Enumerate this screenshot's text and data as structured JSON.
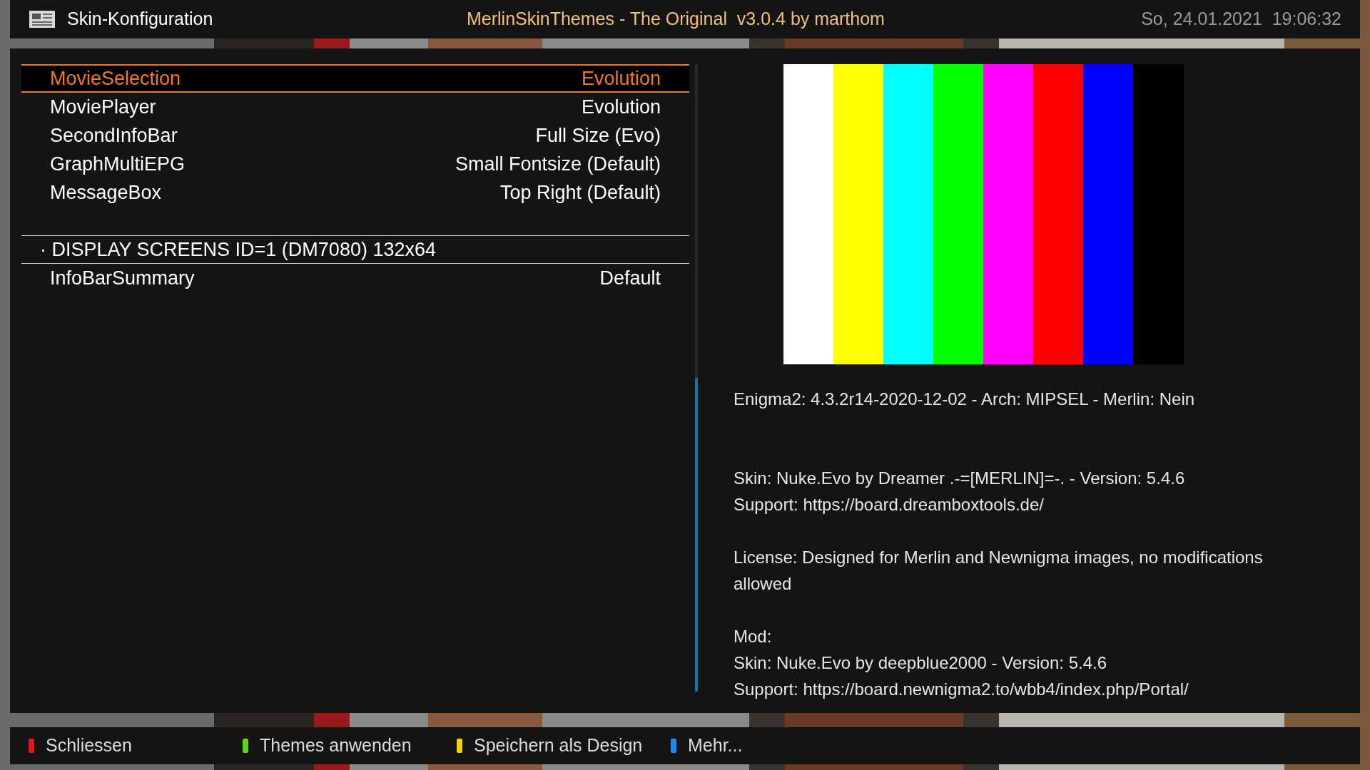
{
  "header": {
    "title": "Skin-Konfiguration",
    "center_title": "MerlinSkinThemes - The Original  v3.0.4 by marthom",
    "datetime": "So, 24.01.2021  19:06:32"
  },
  "list": {
    "rows": [
      {
        "kind": "setting",
        "label": "MovieSelection",
        "value": "Evolution",
        "selected": true
      },
      {
        "kind": "setting",
        "label": "MoviePlayer",
        "value": "Evolution",
        "selected": false
      },
      {
        "kind": "setting",
        "label": "SecondInfoBar",
        "value": "Full Size (Evo)",
        "selected": false
      },
      {
        "kind": "setting",
        "label": "GraphMultiEPG",
        "value": "Small Fontsize (Default)",
        "selected": false
      },
      {
        "kind": "setting",
        "label": "MessageBox",
        "value": "Top Right (Default)",
        "selected": false
      },
      {
        "kind": "section",
        "bullet": "·",
        "label": "DISPLAY SCREENS ID=1 (DM7080) 132x64"
      },
      {
        "kind": "setting",
        "label": "InfoBarSummary",
        "value": "Default",
        "selected": false
      }
    ]
  },
  "info": {
    "paragraphs": [
      {
        "kind": "system",
        "lines": [
          "Enigma2: 4.3.2r14-2020-12-02 - Arch: MIPSEL - Merlin: Nein"
        ]
      },
      {
        "kind": "normal",
        "lines": [
          "Skin: Nuke.Evo by Dreamer .-=[MERLIN]=-. - Version: 5.4.6",
          "Support: https://board.dreamboxtools.de/"
        ]
      },
      {
        "kind": "normal",
        "lines": [
          "License: Designed for Merlin and Newnigma images, no modifications allowed"
        ]
      },
      {
        "kind": "normal",
        "lines": [
          "Mod:",
          "Skin: Nuke.Evo by deepblue2000 - Version: 5.4.6",
          "Support: https://board.newnigma2.to/wbb4/index.php/Portal/"
        ]
      }
    ]
  },
  "buttons": [
    {
      "label": "Schliessen",
      "color": "#e8141a"
    },
    {
      "label": "Themes anwenden",
      "color": "#5ed61a"
    },
    {
      "label": "Speichern als Design",
      "color": "#f2d20c"
    },
    {
      "label": "Mehr...",
      "color": "#1a8ef0"
    }
  ]
}
